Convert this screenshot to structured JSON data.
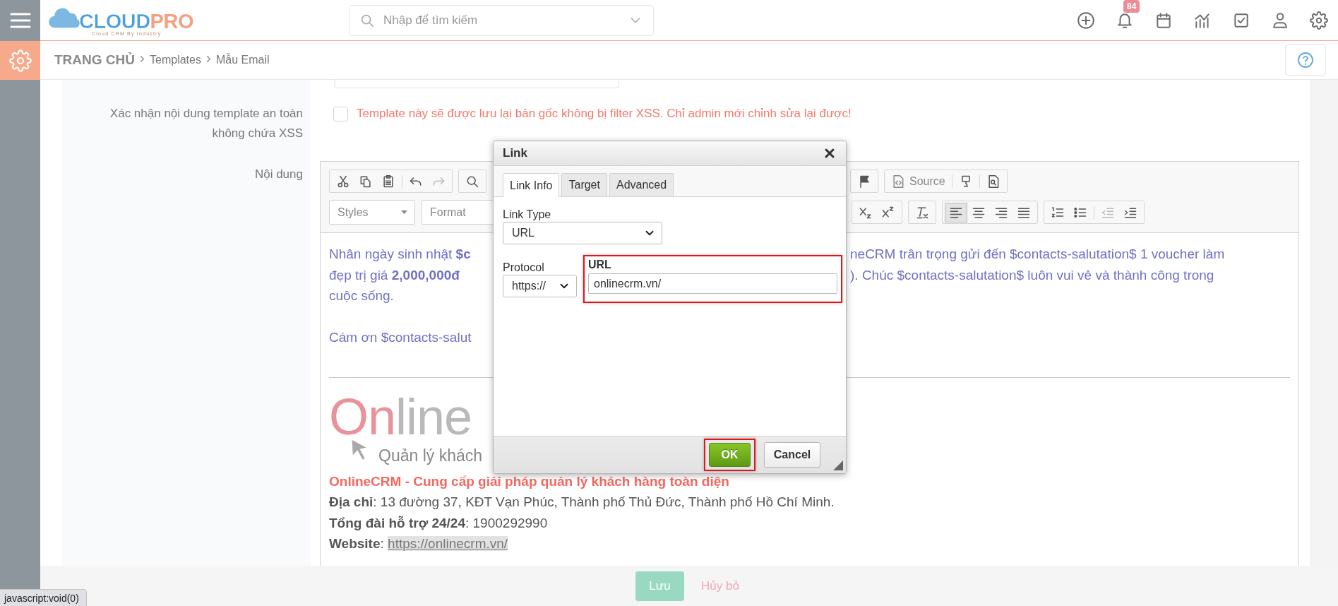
{
  "topbar": {
    "logo": {
      "primary": "CLOUD",
      "secondary": "PRO",
      "tagline": "Cloud CRM By Industry"
    },
    "search": {
      "placeholder": "Nhập để tìm kiếm"
    },
    "notification_badge": "84"
  },
  "breadcrumb": [
    "TRANG CHỦ",
    "Templates",
    "Mẫu Email"
  ],
  "form": {
    "xss": {
      "label": "Xác nhận nội dung template an toàn không chứa XSS",
      "checked": false,
      "note": "Template này sẽ được lưu lại bản gốc không bị filter XSS. Chỉ admin mới chỉnh sửa lại được!"
    },
    "content_label": "Nội dung"
  },
  "editor": {
    "source_label": "Source",
    "styles_label": "Styles",
    "format_label": "Format",
    "align_buttons": [
      {
        "selected": true
      },
      {
        "selected": false
      },
      {
        "selected": false
      },
      {
        "selected": false
      }
    ],
    "lines": [
      {
        "left": "Nhân ngày sinh nhật **$c**",
        "right": "neCRM trân trọng gửi đến $contacts-salutation$ 1 voucher làm"
      },
      {
        "left": "đẹp trị giá **2,000,000đ**",
        "right": "). Chúc $contacts-salutation$ luôn vui vẻ và thành công trong"
      },
      {
        "left": "cuộc sống."
      }
    ],
    "thanks": "Cám ơn $contacts-salut",
    "logo": {
      "parts": [
        {
          "text": "On",
          "color": "#e8939b"
        },
        {
          "text": "line",
          "color": "#b9b9b9"
        }
      ],
      "tagline": "Quản lý khách"
    },
    "signature": {
      "title": "OnlineCRM - Cung cấp giải pháp quản lý khách hàng toàn diện",
      "address": "**Địa chỉ**: 13 đường 37, KĐT Vạn Phúc, Thành phố Thủ Đức, Thành phố Hồ Chí Minh.",
      "hotline": "**Tổng đài hỗ trợ 24/24**: 1900292990",
      "website_label": "**Website**:",
      "website_link": "https://onlinecrm.vn/"
    }
  },
  "dialog": {
    "title": "Link",
    "tabs": [
      {
        "label": "Link Info",
        "selected": true
      },
      {
        "label": "Target",
        "selected": false
      },
      {
        "label": "Advanced",
        "selected": false
      }
    ],
    "link_type": {
      "label": "Link Type",
      "value": "URL"
    },
    "protocol": {
      "label": "Protocol",
      "value": "https://"
    },
    "url": {
      "label": "URL",
      "value": "onlinecrm.vn/",
      "highlighted": true
    },
    "buttons": [
      {
        "label": "OK",
        "kind": "primary",
        "highlighted": true
      },
      {
        "label": "Cancel",
        "kind": "secondary",
        "highlighted": false
      }
    ]
  },
  "footer": {
    "save": "Lưu",
    "cancel": "Hủy bỏ"
  },
  "status_tooltip": "javascript:void(0)"
}
